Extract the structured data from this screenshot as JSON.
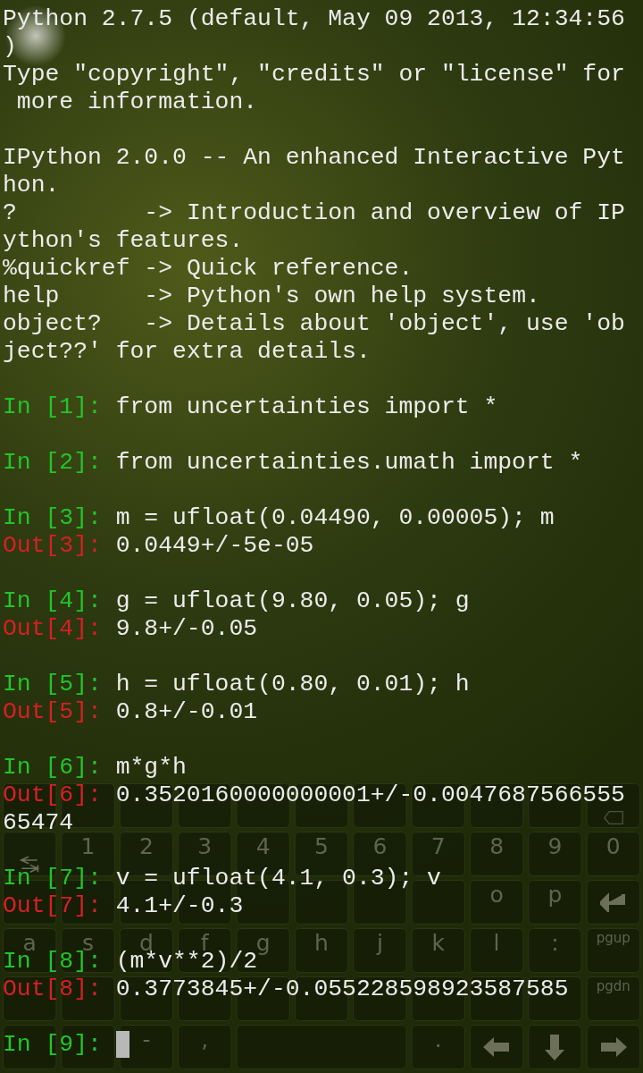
{
  "terminal": {
    "lines": [
      {
        "kind": "text",
        "text": "Python 2.7.5 (default, May 09 2013, 12:34:56"
      },
      {
        "kind": "text",
        "text": ")"
      },
      {
        "kind": "text",
        "text": "Type \"copyright\", \"credits\" or \"license\" for"
      },
      {
        "kind": "text",
        "text": " more information."
      },
      {
        "kind": "blank"
      },
      {
        "kind": "text",
        "text": "IPython 2.0.0 -- An enhanced Interactive Pyt"
      },
      {
        "kind": "text",
        "text": "hon."
      },
      {
        "kind": "text",
        "text": "?         -> Introduction and overview of IP"
      },
      {
        "kind": "text",
        "text": "ython's features."
      },
      {
        "kind": "text",
        "text": "%quickref -> Quick reference."
      },
      {
        "kind": "text",
        "text": "help      -> Python's own help system."
      },
      {
        "kind": "text",
        "text": "object?   -> Details about 'object', use 'ob"
      },
      {
        "kind": "text",
        "text": "ject??' for extra details."
      },
      {
        "kind": "blank"
      },
      {
        "kind": "in",
        "prompt": "In [1]:",
        "text": "from uncertainties import *"
      },
      {
        "kind": "blank"
      },
      {
        "kind": "in",
        "prompt": "In [2]:",
        "text": "from uncertainties.umath import *"
      },
      {
        "kind": "blank"
      },
      {
        "kind": "in",
        "prompt": "In [3]:",
        "text": "m = ufloat(0.04490, 0.00005); m"
      },
      {
        "kind": "out",
        "prompt": "Out[3]:",
        "text": "0.0449+/-5e-05"
      },
      {
        "kind": "blank"
      },
      {
        "kind": "in",
        "prompt": "In [4]:",
        "text": "g = ufloat(9.80, 0.05); g"
      },
      {
        "kind": "out",
        "prompt": "Out[4]:",
        "text": "9.8+/-0.05"
      },
      {
        "kind": "blank"
      },
      {
        "kind": "in",
        "prompt": "In [5]:",
        "text": "h = ufloat(0.80, 0.01); h"
      },
      {
        "kind": "out",
        "prompt": "Out[5]:",
        "text": "0.8+/-0.01"
      },
      {
        "kind": "blank"
      },
      {
        "kind": "in",
        "prompt": "In [6]:",
        "text": "m*g*h"
      },
      {
        "kind": "out",
        "prompt": "Out[6]:",
        "text": "0.3520160000000001+/-0.0047687566555"
      },
      {
        "kind": "text",
        "text": "65474"
      },
      {
        "kind": "blank"
      },
      {
        "kind": "in",
        "prompt": "In [7]:",
        "text": "v = ufloat(4.1, 0.3); v"
      },
      {
        "kind": "out",
        "prompt": "Out[7]:",
        "text": "4.1+/-0.3"
      },
      {
        "kind": "blank"
      },
      {
        "kind": "in",
        "prompt": "In [8]:",
        "text": "(m*v**2)/2"
      },
      {
        "kind": "out",
        "prompt": "Out[8]:",
        "text": "0.3773845+/-0.055228598923587585"
      },
      {
        "kind": "blank"
      },
      {
        "kind": "input",
        "prompt": "In [9]:"
      }
    ]
  },
  "keyboard": {
    "rows": [
      [
        {
          "kind": "blank"
        },
        {
          "kind": "blank"
        },
        {
          "kind": "blank"
        },
        {
          "kind": "blank"
        },
        {
          "kind": "blank"
        },
        {
          "kind": "blank"
        },
        {
          "kind": "blank"
        },
        {
          "kind": "blank"
        },
        {
          "kind": "blank"
        },
        {
          "kind": "blank"
        },
        {
          "kind": "backspace"
        }
      ],
      [
        {
          "kind": "tab"
        },
        {
          "kind": "char",
          "label": "1"
        },
        {
          "kind": "char",
          "label": "2"
        },
        {
          "kind": "char",
          "label": "3"
        },
        {
          "kind": "char",
          "label": "4"
        },
        {
          "kind": "char",
          "label": "5"
        },
        {
          "kind": "char",
          "label": "6"
        },
        {
          "kind": "char",
          "label": "7"
        },
        {
          "kind": "char",
          "label": "8"
        },
        {
          "kind": "char",
          "label": "9"
        },
        {
          "kind": "char",
          "label": "0"
        }
      ],
      [
        {
          "kind": "blank"
        },
        {
          "kind": "blank"
        },
        {
          "kind": "blank"
        },
        {
          "kind": "blank"
        },
        {
          "kind": "blank"
        },
        {
          "kind": "blank"
        },
        {
          "kind": "blank"
        },
        {
          "kind": "blank"
        },
        {
          "kind": "char",
          "label": "o"
        },
        {
          "kind": "char",
          "label": "p"
        },
        {
          "kind": "enter"
        }
      ],
      [
        {
          "kind": "char",
          "label": "a"
        },
        {
          "kind": "char",
          "label": "s"
        },
        {
          "kind": "char",
          "label": "d"
        },
        {
          "kind": "char",
          "label": "f"
        },
        {
          "kind": "char",
          "label": "g"
        },
        {
          "kind": "char",
          "label": "h"
        },
        {
          "kind": "char",
          "label": "j"
        },
        {
          "kind": "char",
          "label": "k"
        },
        {
          "kind": "char",
          "label": "l"
        },
        {
          "kind": "char",
          "label": ":"
        },
        {
          "kind": "small",
          "label": "pgup"
        }
      ],
      [
        {
          "kind": "blank"
        },
        {
          "kind": "blank"
        },
        {
          "kind": "blank"
        },
        {
          "kind": "blank"
        },
        {
          "kind": "blank"
        },
        {
          "kind": "blank"
        },
        {
          "kind": "blank"
        },
        {
          "kind": "blank"
        },
        {
          "kind": "blank"
        },
        {
          "kind": "blank"
        },
        {
          "kind": "small",
          "label": "pgdn"
        }
      ],
      [
        {
          "kind": "blank"
        },
        {
          "kind": "blank"
        },
        {
          "kind": "char",
          "label": "-"
        },
        {
          "kind": "char",
          "label": ","
        },
        {
          "kind": "space"
        },
        "",
        "",
        {
          "kind": "char",
          "label": "."
        },
        {
          "kind": "left"
        },
        {
          "kind": "down"
        },
        {
          "kind": "right"
        }
      ]
    ]
  }
}
